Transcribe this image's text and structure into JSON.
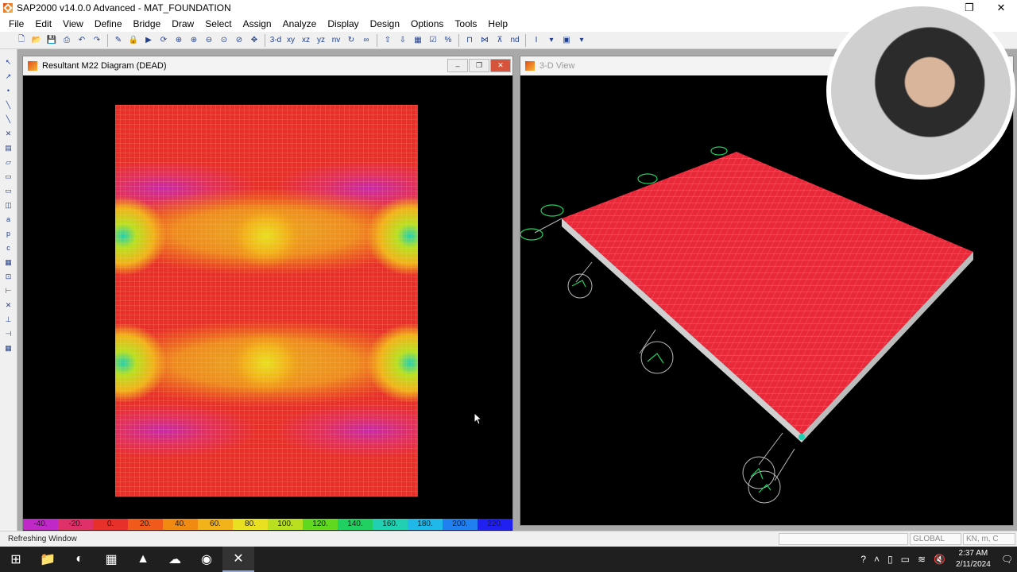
{
  "app": {
    "title": "SAP2000 v14.0.0 Advanced  - MAT_FOUNDATION",
    "window_buttons": [
      "–",
      "❐",
      "✕"
    ]
  },
  "menubar": [
    "File",
    "Edit",
    "View",
    "Define",
    "Bridge",
    "Draw",
    "Select",
    "Assign",
    "Analyze",
    "Display",
    "Design",
    "Options",
    "Tools",
    "Help"
  ],
  "toolbar": {
    "labels": [
      "3-d",
      "xy",
      "xz",
      "yz",
      "nv",
      "nd"
    ]
  },
  "windows": {
    "left": {
      "title": "Resultant M22 Diagram  (DEAD)",
      "buttons": [
        "–",
        "❐",
        "✕"
      ]
    },
    "right": {
      "title": "3-D View"
    }
  },
  "legend": {
    "labels": [
      "-40.",
      "-20.",
      "0.",
      "20.",
      "40.",
      "60.",
      "80.",
      "100.",
      "120.",
      "140.",
      "160.",
      "180.",
      "200.",
      "220."
    ],
    "colors": [
      "#c028c8",
      "#e0306a",
      "#e8302a",
      "#f05a1a",
      "#f08a10",
      "#f2b21a",
      "#e8e020",
      "#b8e020",
      "#60d820",
      "#20d060",
      "#20d0b0",
      "#20b8e8",
      "#2080f0",
      "#2020f0"
    ]
  },
  "statusbar": {
    "message": "Refreshing Window",
    "coord_system": "GLOBAL",
    "units": "KN, m, C"
  },
  "taskbar": {
    "time": "2:37 AM",
    "date": "2/11/2024"
  },
  "colors": {
    "plot_bg": "#000000",
    "mesh_red": "#e8293a",
    "support_green": "#20d060"
  }
}
